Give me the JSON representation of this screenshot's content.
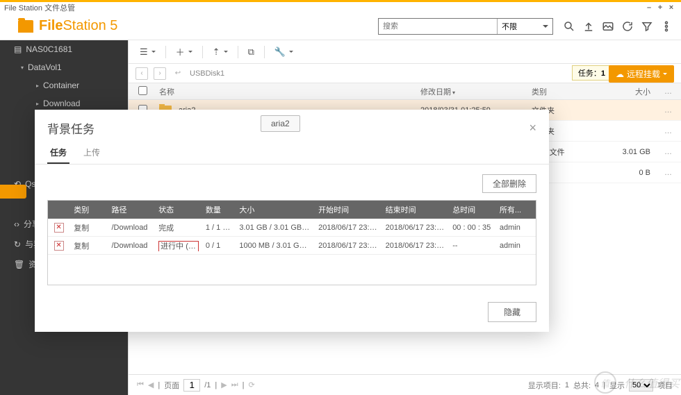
{
  "titlebar": {
    "title": "File Station 文件总管"
  },
  "logo": {
    "bold": "File",
    "thin": "Station 5"
  },
  "search": {
    "placeholder": "搜索",
    "scope": "不限"
  },
  "remote_btn": "远程挂载",
  "tasks_badge": {
    "label": "任务：",
    "count": "1"
  },
  "breadcrumb": {
    "path": "USBDisk1"
  },
  "columns": {
    "name": "名称",
    "date": "修改日期",
    "type": "类别",
    "size": "大小"
  },
  "tree": {
    "root": "NAS0C1681",
    "vol": "DataVol1",
    "children": [
      "Container",
      "Download"
    ],
    "qsync": "Qsy",
    "share": "分享",
    "other1": "与我",
    "other2": "资源"
  },
  "files": [
    {
      "name": "aria2",
      "date": "2018/03/31 01:25:59",
      "type": "文件夹",
      "size": ""
    },
    {
      "name": "",
      "date": "",
      "type": "文件夹",
      "size": ""
    },
    {
      "name": "",
      "date": "",
      "type": "MP4 文件",
      "size": "3.01 GB"
    },
    {
      "name": "",
      "date": "",
      "type": "文件",
      "size": "0 B"
    }
  ],
  "pager": {
    "page_label": "页面",
    "page": "1",
    "total_pages": "/1",
    "footer": {
      "show_items": "显示项目:",
      "total": "总共:",
      "total_val": "4",
      "show": "显示",
      "show_val": "50",
      "items": "项目"
    }
  },
  "modal": {
    "title": "背景任务",
    "chip": "aria2",
    "tabs": {
      "tasks": "任务",
      "upload": "上传"
    },
    "delete_all": "全部删除",
    "hide": "隐藏",
    "columns": {
      "type": "类别",
      "path": "路径",
      "status": "状态",
      "qty": "数量",
      "size": "大小",
      "start": "开始时间",
      "end": "结束时间",
      "total": "总时间",
      "owner": "所有..."
    },
    "rows": [
      {
        "type": "复制",
        "path": "/Download",
        "status": "完成",
        "qty": "1 / 1 (...",
        "size": "3.01 GB / 3.01 GB (...",
        "start": "2018/06/17 23:0...",
        "end": "2018/06/17 23:0...",
        "total": "00 : 00 : 35",
        "owner": "admin"
      },
      {
        "type": "复制",
        "path": "/Download",
        "status": "进行中 (9..",
        "qty": "0 / 1",
        "size": "1000 MB / 3.01 GB (...",
        "start": "2018/06/17 23:0...",
        "end": "2018/06/17 23:0...",
        "total": "--",
        "owner": "admin"
      }
    ]
  },
  "watermark": {
    "icon": "值",
    "text": "·什么值得买"
  }
}
